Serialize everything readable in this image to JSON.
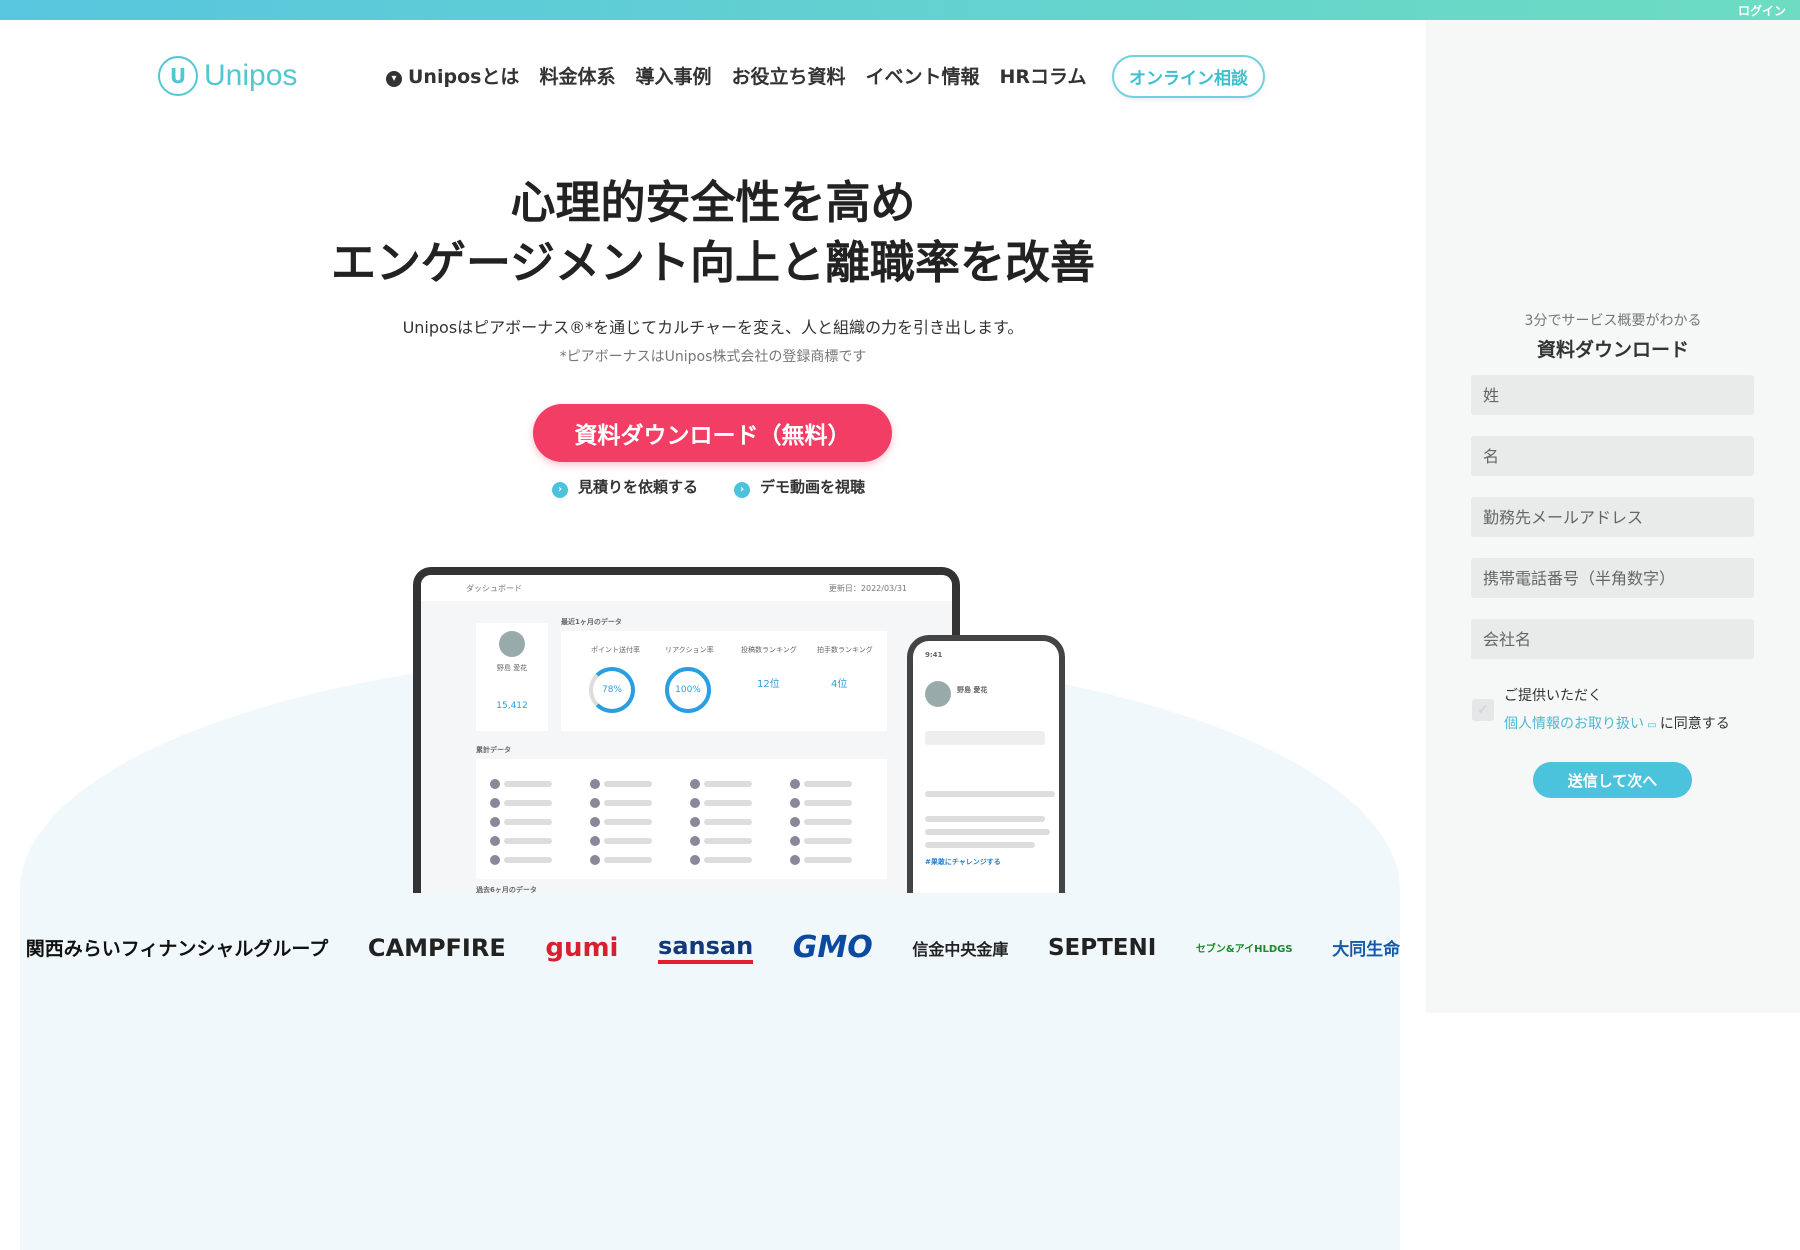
{
  "topbar": {
    "login": "ログイン"
  },
  "header": {
    "logo": "Unipos",
    "nav": [
      "Uniposとは",
      "料金体系",
      "導入事例",
      "お役立ち資料",
      "イベント情報",
      "HRコラム"
    ],
    "cta": "オンライン相談"
  },
  "hero": {
    "title_line1": "心理的安全性を高め",
    "title_line2": "エンゲージメント向上と離職率を改善",
    "subtitle": "Uniposはピアボーナス®*を通じてカルチャーを変え、人と組織の力を引き出します。",
    "note": "*ピアボーナスはUnipos株式会社の登録商標です",
    "cta": "資料ダウンロード（無料）",
    "links": [
      "見積りを依頼する",
      "デモ動画を視聴"
    ]
  },
  "mockup": {
    "dashboard_title": "ダッシュボード",
    "date": "更新日：2022/03/31",
    "section1": "最近1ヶ月のデータ",
    "user_name": "野島 愛花",
    "points": "15,412",
    "metrics": [
      {
        "label": "ポイント送付率",
        "value": "78%"
      },
      {
        "label": "リアクション率",
        "value": "100%"
      },
      {
        "label": "投稿数ランキング",
        "value": "12位"
      },
      {
        "label": "拍手数ランキング",
        "value": "4位"
      }
    ],
    "section2": "累計データ",
    "section3": "過去6ヶ月のデータ",
    "phone_time": "9:41",
    "phone_tag": "#果敢にチャレンジする"
  },
  "logos": [
    "関西みらいフィナンシャルグループ",
    "CAMPFIRE",
    "gumi",
    "sansan",
    "GMO",
    "信金中央金庫",
    "SEPTENI",
    "セブン&アイHLDGS",
    "大同生命"
  ],
  "form": {
    "subtitle": "3分でサービス概要がわかる",
    "title": "資料ダウンロード",
    "fields": [
      "姓",
      "名",
      "勤務先メールアドレス",
      "携帯電話番号（半角数字）",
      "会社名"
    ],
    "agree_line1": "ご提供いただく",
    "agree_link": "個人情報のお取り扱い",
    "agree_suffix": "に同意する",
    "submit": "送信して次へ"
  },
  "colors": {
    "accent": "#4cc3dc",
    "cta": "#f23d64",
    "brand": "#52c7d4"
  }
}
